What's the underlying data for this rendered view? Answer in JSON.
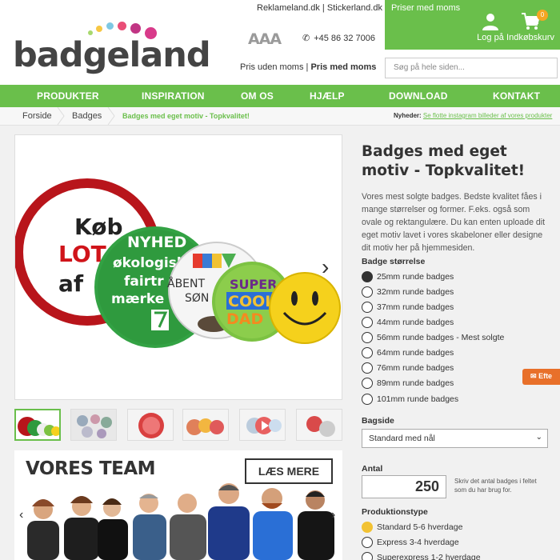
{
  "header": {
    "logo_text": "badgeland",
    "sister_links": [
      "Reklameland.dk",
      "Stickerland.dk"
    ],
    "sister_sep": " | ",
    "aaa_label": "AAA",
    "phone": "+45 86 32 7006",
    "vat_without": "Pris uden moms",
    "vat_sep": " | ",
    "vat_with": "Pris med moms",
    "price_panel_label": "Priser med moms",
    "login_label": "Log på",
    "cart_label": "Indkøbskurv",
    "cart_count": "0",
    "search_placeholder": "Søg på hele siden..."
  },
  "nav": {
    "items": [
      "PRODUKTER",
      "INSPIRATION",
      "OM OS",
      "HJÆLP",
      "DOWNLOAD",
      "KONTAKT"
    ]
  },
  "breadcrumb": {
    "items": [
      "Forside",
      "Badges",
      "Badges med eget motiv - Topkvalitet!"
    ],
    "news_label": "Nyheder:",
    "news_link": "Se flotte instagram billeder af vores produkter"
  },
  "gallery": {
    "badge1_line1": "Køb",
    "badge1_line2": "LOT",
    "badge1_line3": "af",
    "badge2_line1": "NYHED",
    "badge2_line2": "økologisk",
    "badge2_line3": "fairtr",
    "badge2_line4": "mærke",
    "badge3_text": "ÅBENT",
    "badge3_text2": "SØN",
    "badge4_line1": "SUPER",
    "badge4_line2": "COOL",
    "badge4_line3": "DAD"
  },
  "team": {
    "title": "VORES TEAM",
    "button": "LÆS MERE"
  },
  "product": {
    "title": "Badges med eget motiv - Topkvalitet!",
    "description": "Vores mest solgte badges. Bedste kvalitet fåes i mange størrelser og former. F.eks. også som ovale og rektangulære. Du kan enten uploade dit eget motiv lavet i vores skabeloner eller designe dit motiv her på hjemmesiden.",
    "size_label": "Badge størrelse",
    "sizes": [
      "25mm runde badges",
      "32mm runde badges",
      "37mm runde badges",
      "44mm runde badges",
      "56mm runde badges - Mest solgte",
      "64mm runde badges",
      "76mm runde badges",
      "89mm runde badges",
      "101mm runde badges"
    ],
    "selected_size": 0,
    "back_label": "Bagside",
    "back_value": "Standard med nål",
    "qty_label": "Antal",
    "qty_value": "250",
    "qty_hint": "Skriv det antal badges i feltet som du har brug for.",
    "prod_label": "Produktionstype",
    "prod_options": [
      "Standard 5-6 hverdage",
      "Express 3-4 hverdage",
      "Superexpress 1-2 hverdage"
    ],
    "selected_prod": 0
  },
  "side_tab": {
    "label": "Efte"
  },
  "colors": {
    "brand_green": "#6abf4b",
    "accent_orange": "#e8702a",
    "accent_yellow": "#f2c233"
  }
}
